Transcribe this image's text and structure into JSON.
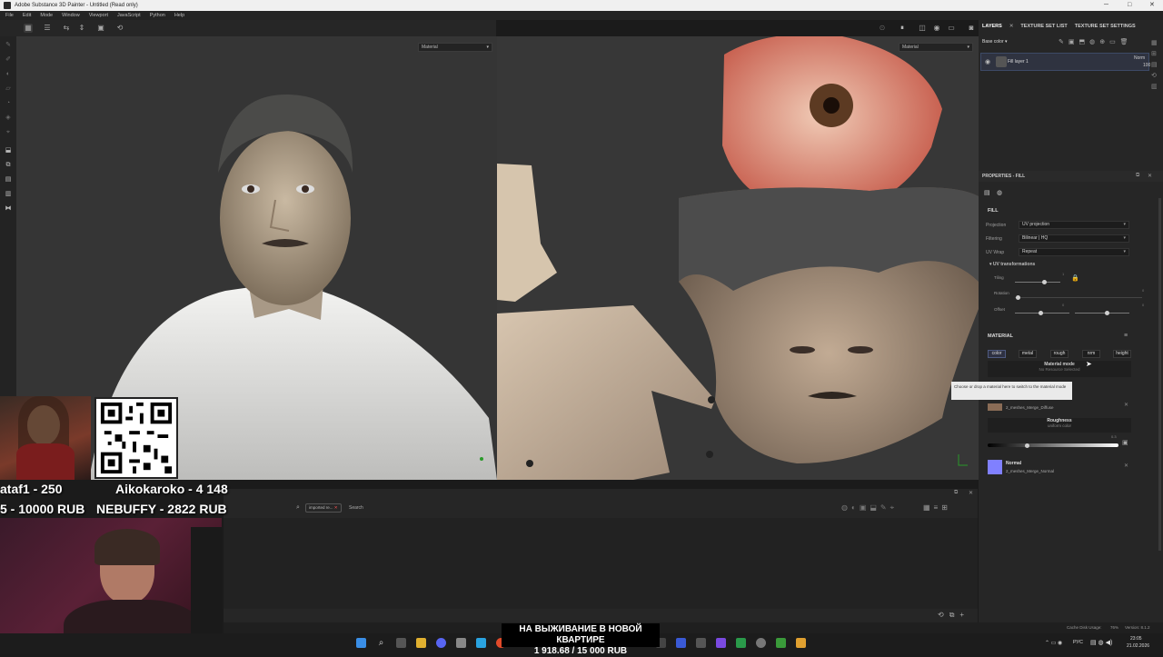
{
  "window": {
    "title": "Adobe Substance 3D Painter - Untitled (Read only)"
  },
  "menu": [
    "File",
    "Edit",
    "Mode",
    "Window",
    "Viewport",
    "JavaScript",
    "Python",
    "Help"
  ],
  "viewport": {
    "left_channel": "Material",
    "right_channel": "Material"
  },
  "layers": {
    "tabs": [
      "LAYERS",
      "TEXTURE SET LIST",
      "TEXTURE SET SETTINGS"
    ],
    "channel": "Base color",
    "item": {
      "name": "Fill layer 1",
      "blend": "Norm",
      "opacity": "100"
    }
  },
  "properties": {
    "title": "PROPERTIES - FILL",
    "fill_heading": "FILL",
    "projection_label": "Projection",
    "projection_value": "UV projection",
    "filtering_label": "Filtering",
    "filtering_value": "Bilinear | HQ",
    "uvwrap_label": "UV Wrap",
    "uvwrap_value": "Repeat",
    "uvtrans": "UV transformations",
    "tiling_label": "Tiling",
    "tiling_value": "1",
    "rotation_label": "Rotation",
    "rotation_value": "0",
    "offset_label": "Offset",
    "offset_x": "0",
    "offset_y": "0",
    "material_heading": "MATERIAL",
    "chips": [
      "color",
      "metal",
      "rough",
      "nrm",
      "height"
    ],
    "material_mode": "Material mode",
    "no_resource": "No Resource Selected",
    "tooltip": "Choose or drop a material here to switch to the material mode",
    "basecolor_resource": "2_meshes_Merge_Diffuse",
    "roughness_title": "Roughness",
    "roughness_sub": "uniform color",
    "roughness_value": "0.3",
    "normal_title": "Normal",
    "normal_resource": "2_meshes_Merge_Normal"
  },
  "assets": {
    "filter_tag": "imported re...",
    "search_placeholder": "Search"
  },
  "status": {
    "cache": "Cache Disk Usage:",
    "cache_pct": "76%",
    "version": "Version: 8.1.2"
  },
  "stream": {
    "donor1": "ataf1 - 250",
    "donor2": "Aikokaroko - 4 148",
    "donor3": "5 - 10000 RUB",
    "donor4": "NEBUFFY - 2822 RUB",
    "banner_title": "НА ВЫЖИВАНИЕ В НОВОЙ КВАРТИРЕ",
    "banner_value": "1 918.68 / 15 000 RUB"
  },
  "taskbar": {
    "lang": "РУС",
    "time": "23:05",
    "date": "21.02.2026"
  }
}
